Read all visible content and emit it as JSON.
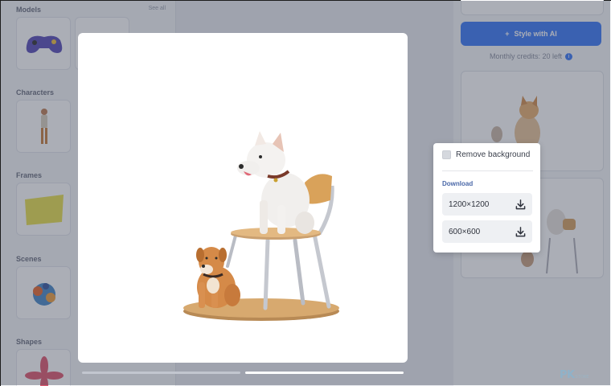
{
  "sidebar": {
    "see_all": "See all",
    "sections": [
      {
        "title": "Models"
      },
      {
        "title": "Characters"
      },
      {
        "title": "Frames"
      },
      {
        "title": "Scenes"
      },
      {
        "title": "Shapes"
      }
    ]
  },
  "right_panel": {
    "style_button": "Style with AI",
    "credits": "Monthly credits: 20 left"
  },
  "popover": {
    "remove_background": "Remove background",
    "download_title": "Download",
    "options": [
      {
        "size": "1200×1200"
      },
      {
        "size": "600×600"
      }
    ]
  },
  "watermark": {
    "main": "PK",
    "sub": "STORE"
  },
  "colors": {
    "accent": "#3d7bf6",
    "overlay": "rgba(55,62,82,0.42)"
  }
}
